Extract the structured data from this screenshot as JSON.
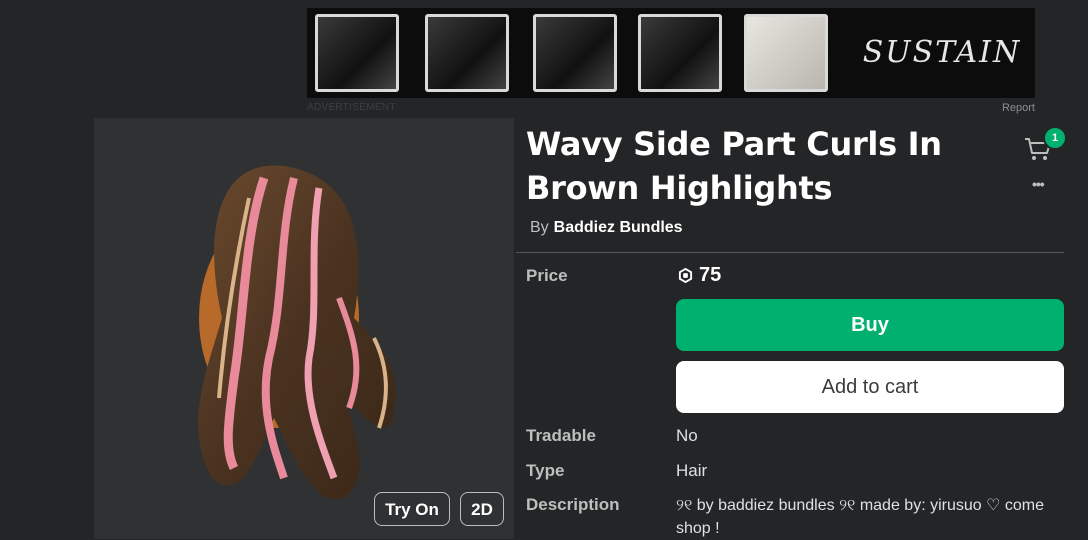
{
  "ad": {
    "label": "ADVERTISEMENT",
    "report": "Report",
    "brand_logo_text": "SUSTAIN"
  },
  "thumbnail": {
    "try_on_label": "Try On",
    "view_2d_label": "2D"
  },
  "item": {
    "title": "Wavy Side Part Curls In Brown Highlights",
    "by_label": "By",
    "creator_name": "Baddiez Bundles"
  },
  "header": {
    "cart_count": "1",
    "more_icon": "ellipsis-icon"
  },
  "details": {
    "price_label": "Price",
    "price_value": "75",
    "buy_label": "Buy",
    "add_to_cart_label": "Add to cart",
    "tradable_label": "Tradable",
    "tradable_value": "No",
    "type_label": "Type",
    "type_value": "Hair",
    "description_label": "Description",
    "description_value": "୨୧ by baddiez bundles ୨୧ made by: yirusuo ♡ come shop !"
  },
  "colors": {
    "buy_green": "#00b06f",
    "background": "#232527",
    "panel": "#2f3133"
  }
}
